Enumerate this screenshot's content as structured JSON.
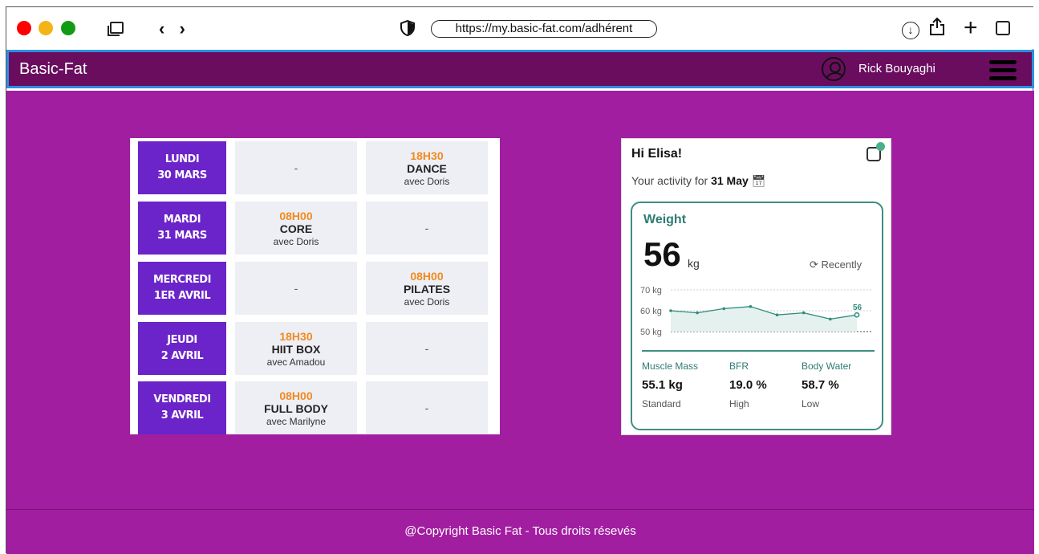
{
  "browser": {
    "url": "https://my.basic-fat.com/adhérent",
    "nav_arrows": "‹ ›"
  },
  "header": {
    "brand": "Basic-Fat",
    "user_name": "Rick Bouyaghi"
  },
  "schedule": [
    {
      "day": "LUNDI",
      "date": "30 MARS",
      "c1": {
        "empty": "-"
      },
      "c2": {
        "time": "18H30",
        "class": "DANCE",
        "coach": "avec Doris"
      }
    },
    {
      "day": "MARDI",
      "date": "31 MARS",
      "c1": {
        "time": "08H00",
        "class": "CORE",
        "coach": "avec Doris"
      },
      "c2": {
        "empty": "-"
      }
    },
    {
      "day": "MERCREDI",
      "date": "1ER AVRIL",
      "c1": {
        "empty": "-"
      },
      "c2": {
        "time": "08H00",
        "class": "PILATES",
        "coach": "avec Doris"
      }
    },
    {
      "day": "JEUDI",
      "date": "2 AVRIL",
      "c1": {
        "time": "18H30",
        "class": "HIIT BOX",
        "coach": "avec Amadou"
      },
      "c2": {
        "empty": "-"
      }
    },
    {
      "day": "VENDREDI",
      "date": "3 AVRIL",
      "c1": {
        "time": "08H00",
        "class": "FULL BODY",
        "coach": "avec Marilyne"
      },
      "c2": {
        "empty": "-"
      }
    }
  ],
  "card": {
    "greeting": "Hi Elisa!",
    "activity_prefix": "Your activity for",
    "activity_date": "31 May",
    "weight_title": "Weight",
    "weight_value": "56",
    "weight_unit": "kg",
    "recent_label": "Recently",
    "stats": [
      {
        "label": "Muscle Mass",
        "value": "55.1 kg",
        "sub": "Standard"
      },
      {
        "label": "BFR",
        "value": "19.0 %",
        "sub": "High"
      },
      {
        "label": "Body Water",
        "value": "58.7 %",
        "sub": "Low"
      }
    ]
  },
  "chart_data": {
    "type": "line",
    "y_ticks": [
      "70 kg",
      "60 kg",
      "50 kg"
    ],
    "ylim": [
      50,
      70
    ],
    "values": [
      60,
      59,
      61,
      62,
      58,
      59,
      56,
      58
    ],
    "last_label": "56"
  },
  "footer": {
    "text": "@Copyright Basic Fat - Tous droits résevés"
  },
  "colors": {
    "header_bg": "#6a0d5f",
    "page_bg": "#a21ea1",
    "day_bg": "#6b24c9",
    "time_accent": "#f28a1e",
    "teal": "#3e8e82"
  }
}
